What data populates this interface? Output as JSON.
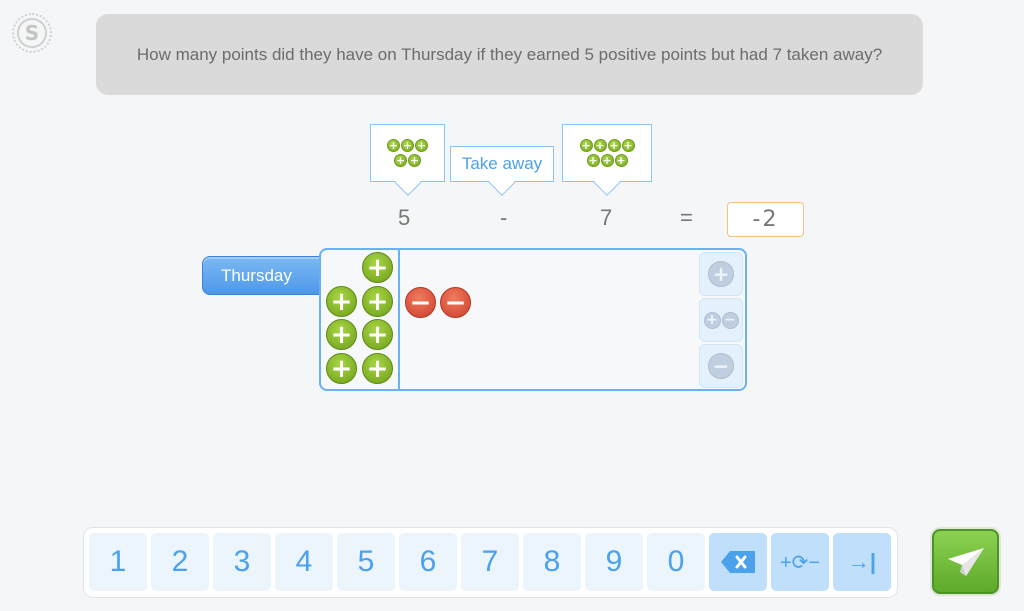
{
  "logo": {
    "letter": "S"
  },
  "question": {
    "text": "How many points did they have on Thursday if they earned 5 positive points but had 7 taken away?"
  },
  "equation": {
    "left_bubble": {
      "rows": [
        3,
        2
      ],
      "symbol": "+"
    },
    "operator_bubble": {
      "label": "Take away"
    },
    "right_bubble": {
      "rows": [
        4,
        3
      ],
      "symbol": "+"
    },
    "left_value": "5",
    "operator": "-",
    "right_value": "7",
    "equals": "=",
    "answer": "-2"
  },
  "board": {
    "day_label": "Thursday",
    "positive_count": 7,
    "negative_count": 2,
    "positive_symbol": "+",
    "negative_symbol": "−",
    "side_buttons": [
      {
        "name": "add-positive",
        "symbol": "+"
      },
      {
        "name": "add-zero-pair",
        "symbol": "+−"
      },
      {
        "name": "add-negative",
        "symbol": "−"
      }
    ]
  },
  "keypad": {
    "digits": [
      "1",
      "2",
      "3",
      "4",
      "5",
      "6",
      "7",
      "8",
      "9",
      "0"
    ],
    "backspace_icon": "backspace-icon",
    "sign_toggle_label": "+⟳−",
    "tab_label": "→|"
  },
  "submit": {
    "icon": "paper-plane-icon"
  },
  "colors": {
    "accent": "#4ba1ec",
    "positive": "#8cc33a",
    "negative": "#e0533e",
    "answer_border": "#f1c27c",
    "submit": "#6cbb35"
  }
}
